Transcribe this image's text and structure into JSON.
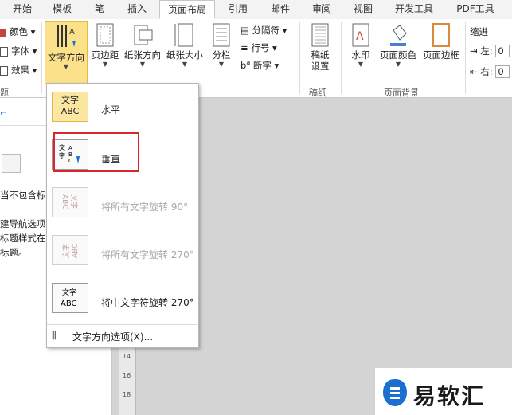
{
  "tabs": [
    "开始",
    "模板",
    "笔",
    "插入",
    "页面布局",
    "引用",
    "邮件",
    "审阅",
    "视图",
    "开发工具",
    "PDF工具"
  ],
  "active_tab": "页面布局",
  "ribbon": {
    "left_small": [
      "颜色",
      "字体",
      "效果"
    ],
    "text_direction": "文字方向",
    "margins": "页边距",
    "orientation": "纸张方向",
    "size": "纸张大小",
    "columns": "分栏",
    "breaks": "分隔符",
    "line_numbers": "行号",
    "hyphenation": "断字",
    "draft_settings_1": "稿纸",
    "draft_settings_2": "设置",
    "watermark": "水印",
    "page_color": "页面颜色",
    "page_border": "页面边框",
    "indent": "缩进",
    "indent_left": "左:",
    "indent_right": "右:",
    "indent_left_val": "0",
    "indent_right_val": "0",
    "group_draft": "稿纸",
    "group_page_bg": "页面背景",
    "group_left": "题"
  },
  "left_pane": {
    "line1": "当不包含标",
    "line2": "建导航选项",
    "line3": "标题样式在",
    "line4": "标题。"
  },
  "menu": {
    "horizontal_pic": "文字\nABC",
    "horizontal": "水平",
    "vertical": "垂直",
    "rotate90": "将所有文字旋转 90°",
    "rotate270": "将所有文字旋转 270°",
    "rotate_cjk270": "将中文字符旋转 270°",
    "options": "文字方向选项(X)..."
  },
  "ruler_numbers": [
    "14",
    "16",
    "18"
  ],
  "watermark_text": "易软汇",
  "colors": {
    "accent": "#fbe28a",
    "highlight_border": "#d9262c",
    "brand": "#1b6fd1"
  }
}
